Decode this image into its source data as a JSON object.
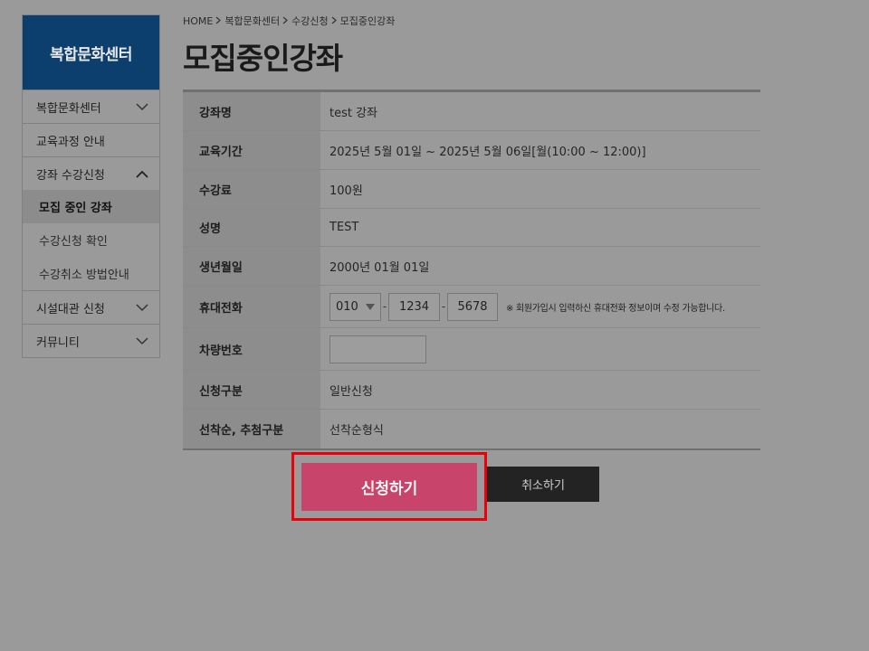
{
  "sidebar": {
    "title": "복합문화센터",
    "items": [
      {
        "label": "복합문화센터",
        "icon": "chevron-down"
      },
      {
        "label": "교육과정 안내"
      },
      {
        "label": "강좌 수강신청",
        "icon": "chevron-up"
      },
      {
        "label": "시설대관 신청",
        "icon": "chevron-down"
      },
      {
        "label": "커뮤니티",
        "icon": "chevron-down"
      }
    ],
    "subitems": [
      {
        "label": "모집 중인 강좌",
        "active": true
      },
      {
        "label": "수강신청 확인"
      },
      {
        "label": "수강취소 방법안내"
      }
    ]
  },
  "breadcrumb": {
    "home": "HOME",
    "level1": "복합문화센터",
    "level2": "수강신청",
    "level3": "모집중인강좌"
  },
  "page_title": "모집중인강좌",
  "form": {
    "course_name": {
      "label": "강좌명",
      "value": "test 강좌"
    },
    "period": {
      "label": "교육기간",
      "value": "2025년 5월 01일 ~ 2025년 5월 06일[월(10:00 ~ 12:00)]"
    },
    "fee": {
      "label": "수강료",
      "value": "100원"
    },
    "name": {
      "label": "성명",
      "value": "TEST"
    },
    "birth": {
      "label": "생년월일",
      "value": "2000년 01월 01일"
    },
    "phone": {
      "label": "휴대전화",
      "prefix": "010",
      "middle": "1234",
      "last": "5678",
      "dash": "-",
      "note": "※ 회원가입시 입력하신 휴대전화 정보이며 수정 가능합니다."
    },
    "car": {
      "label": "차량번호",
      "value": ""
    },
    "apply_type": {
      "label": "신청구분",
      "value": "일반신청"
    },
    "selection": {
      "label": "선착순, 추첨구분",
      "value": "선착순형식"
    }
  },
  "buttons": {
    "apply": "신청하기",
    "cancel": "취소하기"
  },
  "colors": {
    "sidebar_header": "#0d3f6e",
    "apply_button": "#c8446a",
    "cancel_button": "#232323",
    "highlight_border": "#e8000b"
  }
}
